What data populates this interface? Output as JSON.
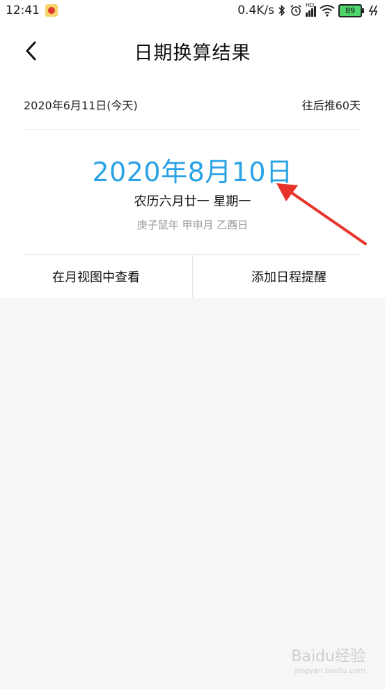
{
  "status_bar": {
    "time": "12:41",
    "network_speed": "0.4K/s",
    "hd_label": "HD",
    "battery_level": "89",
    "icons": [
      "tomato-app-icon",
      "bluetooth-icon",
      "alarm-icon",
      "signal-icon",
      "wifi-icon",
      "battery-icon",
      "charging-icon"
    ]
  },
  "header": {
    "title": "日期换算结果",
    "back_icon": "chevron-left-icon"
  },
  "info": {
    "start_date": "2020年6月11日(今天)",
    "offset": "往后推60天"
  },
  "result": {
    "date": "2020年8月10日",
    "lunar": "农历六月廿一 星期一",
    "ganzhi": "庚子鼠年 甲申月 乙酉日"
  },
  "actions": {
    "month_view": "在月视图中查看",
    "add_reminder": "添加日程提醒"
  },
  "watermark": {
    "brand": "Baidu经验",
    "url": "jingyan.baidu.com"
  },
  "colors": {
    "accent": "#2aa3e6",
    "annotation_arrow": "#e8332b",
    "background": "#f6f6f6"
  }
}
